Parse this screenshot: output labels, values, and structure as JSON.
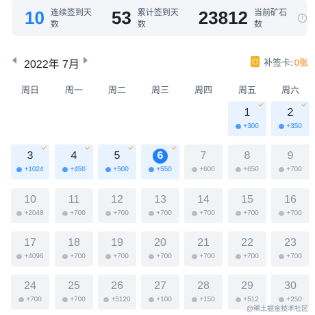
{
  "stats": {
    "consecutive_days": "10",
    "consecutive_label": "连续签到天数",
    "total_days": "53",
    "total_label": "累计签到天数",
    "ore": "23812",
    "ore_label": "当前矿石数",
    "info_icon": "info-circle-icon"
  },
  "calendar": {
    "month_label": "2022年 7月",
    "makeup_label": "补签卡:",
    "makeup_count": "0张",
    "weekdays": [
      "周日",
      "周一",
      "周二",
      "周三",
      "周四",
      "周五",
      "周六"
    ],
    "days": [
      {
        "day": "1",
        "reward": "+300",
        "signed": true
      },
      {
        "day": "2",
        "reward": "+350",
        "signed": true
      },
      {
        "day": "3",
        "reward": "+1024",
        "signed": true
      },
      {
        "day": "4",
        "reward": "+450",
        "signed": true
      },
      {
        "day": "5",
        "reward": "+500",
        "signed": true
      },
      {
        "day": "6",
        "reward": "+550",
        "signed": true,
        "today": true
      },
      {
        "day": "7",
        "reward": "+600",
        "signed": false
      },
      {
        "day": "8",
        "reward": "+650",
        "signed": false
      },
      {
        "day": "9",
        "reward": "+700",
        "signed": false
      },
      {
        "day": "10",
        "reward": "+2048",
        "signed": false
      },
      {
        "day": "11",
        "reward": "+700",
        "signed": false
      },
      {
        "day": "12",
        "reward": "+700",
        "signed": false
      },
      {
        "day": "13",
        "reward": "+700",
        "signed": false
      },
      {
        "day": "14",
        "reward": "+700",
        "signed": false
      },
      {
        "day": "15",
        "reward": "+700",
        "signed": false
      },
      {
        "day": "16",
        "reward": "+700",
        "signed": false
      },
      {
        "day": "17",
        "reward": "+4096",
        "signed": false
      },
      {
        "day": "18",
        "reward": "+700",
        "signed": false
      },
      {
        "day": "19",
        "reward": "+700",
        "signed": false
      },
      {
        "day": "20",
        "reward": "+700",
        "signed": false
      },
      {
        "day": "21",
        "reward": "+700",
        "signed": false
      },
      {
        "day": "22",
        "reward": "+700",
        "signed": false
      },
      {
        "day": "23",
        "reward": "+700",
        "signed": false
      },
      {
        "day": "24",
        "reward": "+700",
        "signed": false
      },
      {
        "day": "25",
        "reward": "+700",
        "signed": false
      },
      {
        "day": "26",
        "reward": "+5120",
        "signed": false
      },
      {
        "day": "27",
        "reward": "+100",
        "signed": false
      },
      {
        "day": "28",
        "reward": "+150",
        "signed": false
      },
      {
        "day": "29",
        "reward": "+512",
        "signed": false
      },
      {
        "day": "30",
        "reward": "+250",
        "signed": false
      }
    ],
    "first_weekday": 5
  },
  "watermark": "@稀土掘金技术社区",
  "colors": {
    "accent": "#1e80ff",
    "signed_bg": "#e8f3ff",
    "unsigned_bg": "#f2f3f5",
    "check": "#f59a23",
    "makeup": "#ff7d00"
  }
}
